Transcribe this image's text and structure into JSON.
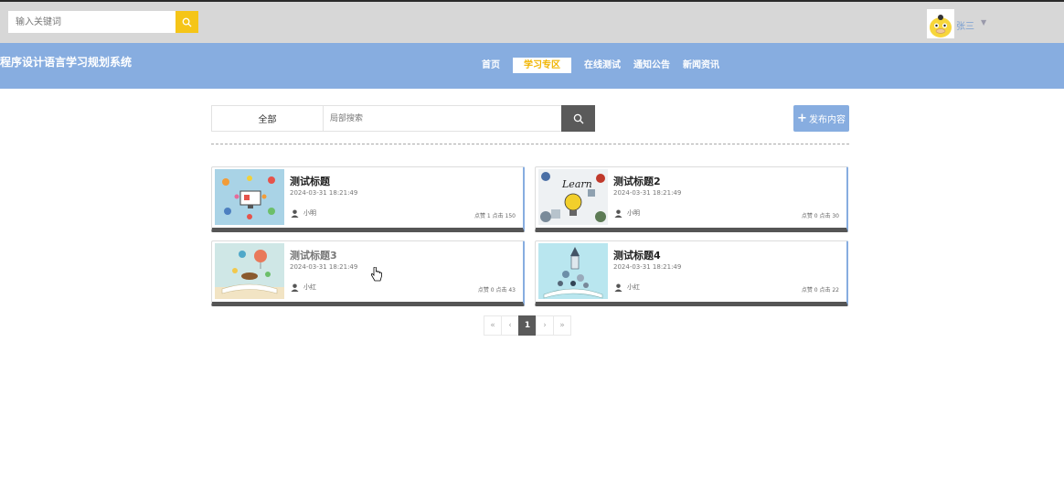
{
  "top": {
    "search_placeholder": "输入关键词",
    "username": "张三"
  },
  "nav": {
    "brand": "程序设计语言学习规划系统",
    "items": [
      "首页",
      "学习专区",
      "在线测试",
      "通知公告",
      "新闻资讯"
    ],
    "active_index": 1
  },
  "filter": {
    "category": "全部",
    "search_placeholder": "局部搜索",
    "publish_label": "发布内容"
  },
  "cards": [
    {
      "title": "测试标题",
      "time": "2024-03-31 18:21:49",
      "author": "小明",
      "stats": "点赞 1   点击 150",
      "image": "tech-illustration"
    },
    {
      "title": "测试标题2",
      "time": "2024-03-31 18:21:49",
      "author": "小明",
      "stats": "点赞 0   点击 30",
      "image": "learn-lightbulb"
    },
    {
      "title": "测试标题3",
      "time": "2024-03-31 18:21:49",
      "author": "小红",
      "stats": "点赞 0   点击 43",
      "image": "open-book-balloon"
    },
    {
      "title": "测试标题4",
      "time": "2024-03-31 18:21:49",
      "author": "小红",
      "stats": "点赞 0   点击 22",
      "image": "book-rocket"
    }
  ],
  "pagination": {
    "first": "«",
    "prev": "‹",
    "current": "1",
    "next": "›",
    "last": "»"
  },
  "colors": {
    "nav_blue": "#87ade0",
    "accent_yellow": "#f5c518",
    "active_text": "#f0b400",
    "dark_gray": "#5a5a5a"
  }
}
